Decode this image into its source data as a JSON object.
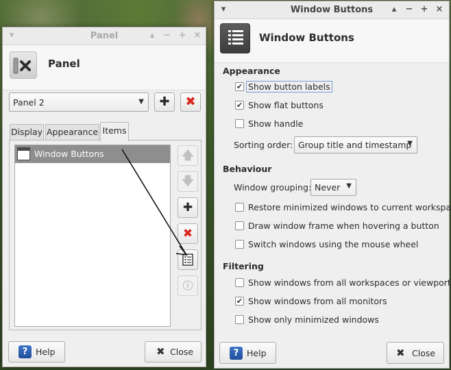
{
  "panel_window": {
    "title": "Panel",
    "header_title": "Panel",
    "panel_select": "Panel 2",
    "tabs": [
      "Display",
      "Appearance",
      "Items"
    ],
    "items": [
      "Window Buttons"
    ],
    "help_label": "Help",
    "close_label": "Close",
    "titlebar_buttons": {
      "menu": "▾",
      "up": "▴",
      "min": "−",
      "max": "+",
      "close": "×"
    }
  },
  "wb_window": {
    "title": "Window Buttons",
    "header_title": "Window Buttons",
    "sections": {
      "appearance": "Appearance",
      "behaviour": "Behaviour",
      "filtering": "Filtering"
    },
    "options": {
      "show_button_labels": {
        "label": "Show button labels",
        "checked": true
      },
      "show_flat_buttons": {
        "label": "Show flat buttons",
        "checked": true
      },
      "show_handle": {
        "label": "Show handle",
        "checked": false
      },
      "restore_minimized": {
        "label": "Restore minimized windows to current workspace",
        "checked": false
      },
      "draw_frame": {
        "label": "Draw window frame when hovering a button",
        "checked": false
      },
      "switch_wheel": {
        "label": "Switch windows using the mouse wheel",
        "checked": false
      },
      "all_workspaces": {
        "label": "Show windows from all workspaces or viewports",
        "checked": false
      },
      "all_monitors": {
        "label": "Show windows from all monitors",
        "checked": true
      },
      "only_minimized": {
        "label": "Show only minimized windows",
        "checked": false
      }
    },
    "sorting_label": "Sorting order:",
    "sorting_value": "Group title and timestamp",
    "grouping_label": "Window grouping:",
    "grouping_value": "Never",
    "help_label": "Help",
    "close_label": "Close",
    "titlebar_buttons": {
      "menu": "▾",
      "up": "▴",
      "min": "−",
      "max": "+",
      "close": "×"
    }
  },
  "colors": {
    "selection": "#8e8e8e",
    "remove_red": "#d8261d",
    "help_blue": "#2a5db0"
  }
}
